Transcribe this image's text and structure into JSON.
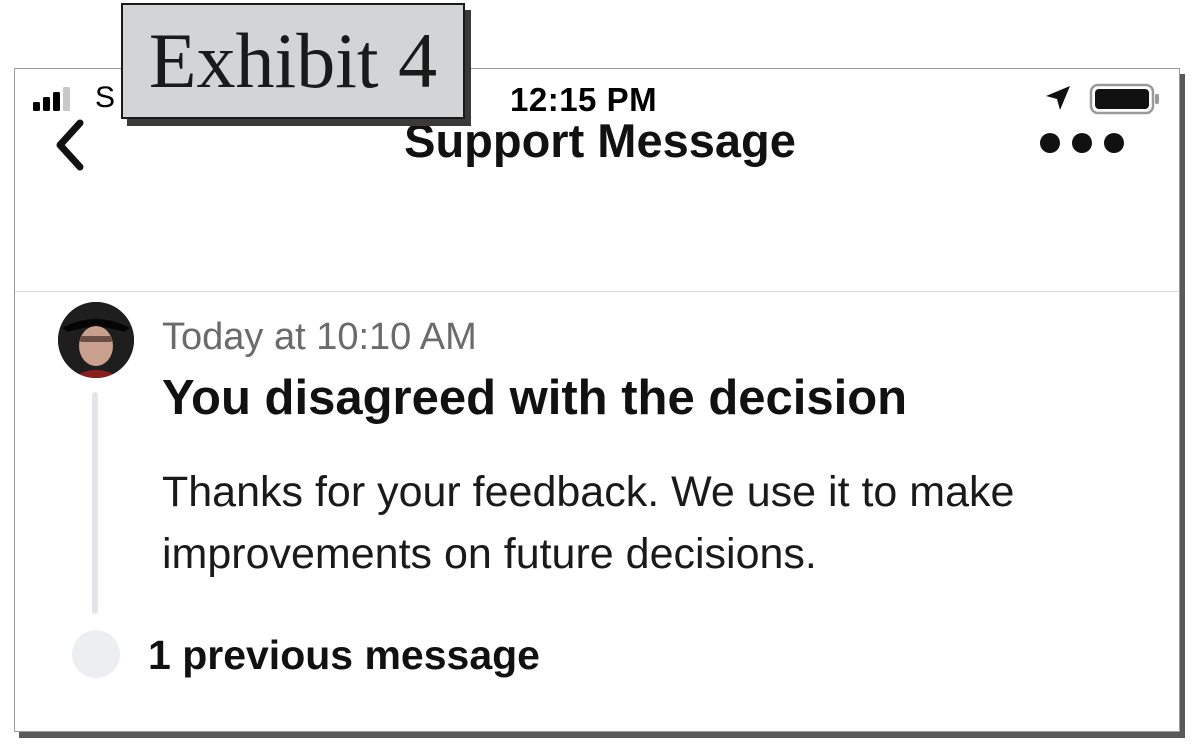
{
  "exhibit": {
    "label": "Exhibit 4"
  },
  "status_bar": {
    "carrier": "S",
    "time": "12:15 PM",
    "signal_icon": "signal-bars-icon",
    "location_icon": "location-arrow-icon",
    "battery_icon": "battery-icon"
  },
  "nav": {
    "back_icon": "chevron-left-icon",
    "title": "Support Message",
    "more_icon": "more-dots-icon"
  },
  "message": {
    "timestamp": "Today at 10:10 AM",
    "headline": "You disagreed with the decision",
    "body": "Thanks for your feedback. We use it to make improvements on future decisions."
  },
  "previous": {
    "label": "1 previous message"
  },
  "colors": {
    "text_primary": "#111111",
    "text_secondary": "#6b6b6b",
    "timeline": "#e3e5ea",
    "divider": "#dcdcdc",
    "exhibit_background": "#d3d4d6"
  }
}
